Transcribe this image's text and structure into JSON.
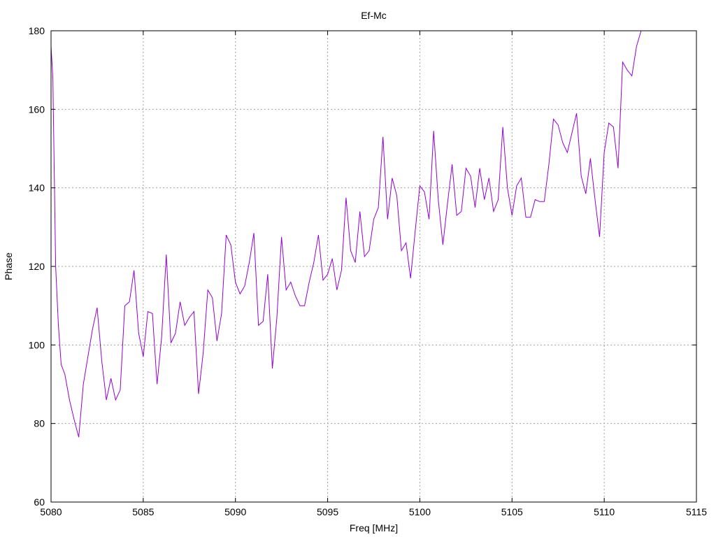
{
  "chart_data": {
    "type": "line",
    "title": "Ef-Mc",
    "xlabel": "Freq [MHz]",
    "ylabel": "Phase",
    "xlim": [
      5080,
      5115
    ],
    "ylim": [
      60,
      180
    ],
    "x_ticks": [
      5080,
      5085,
      5090,
      5095,
      5100,
      5105,
      5110,
      5115
    ],
    "y_ticks": [
      60,
      80,
      100,
      120,
      140,
      160,
      180
    ],
    "grid": true,
    "line_color": "#9400d3",
    "series": [
      {
        "x": [
          5080.0,
          5080.1,
          5080.25,
          5080.4,
          5080.55,
          5080.75,
          5081.0,
          5081.25,
          5081.5,
          5081.75,
          5082.0,
          5082.25,
          5082.5,
          5082.75,
          5083.0,
          5083.25,
          5083.5,
          5083.75,
          5084.0,
          5084.25,
          5084.5,
          5084.75,
          5085.0,
          5085.25,
          5085.5,
          5085.75,
          5086.0,
          5086.25,
          5086.5,
          5086.75,
          5087.0,
          5087.25,
          5087.5,
          5087.75,
          5088.0,
          5088.25,
          5088.5,
          5088.75,
          5089.0,
          5089.25,
          5089.5,
          5089.75,
          5090.0,
          5090.25,
          5090.5,
          5090.75,
          5091.0,
          5091.25,
          5091.5,
          5091.75,
          5092.0,
          5092.25,
          5092.5,
          5092.75,
          5093.0,
          5093.25,
          5093.5,
          5093.75,
          5094.0,
          5094.25,
          5094.5,
          5094.75,
          5095.0,
          5095.25,
          5095.5,
          5095.75,
          5096.0,
          5096.25,
          5096.5,
          5096.75,
          5097.0,
          5097.25,
          5097.5,
          5097.75,
          5098.0,
          5098.25,
          5098.5,
          5098.75,
          5099.0,
          5099.25,
          5099.5,
          5099.75,
          5100.0,
          5100.25,
          5100.5,
          5100.75,
          5101.0,
          5101.25,
          5101.5,
          5101.75,
          5102.0,
          5102.25,
          5102.5,
          5102.75,
          5103.0,
          5103.25,
          5103.5,
          5103.75,
          5104.0,
          5104.25,
          5104.5,
          5104.75,
          5105.0,
          5105.25,
          5105.5,
          5105.75,
          5106.0,
          5106.25,
          5106.5,
          5106.75,
          5107.0,
          5107.25,
          5107.5,
          5107.75,
          5108.0,
          5108.25,
          5108.5,
          5108.75,
          5109.0,
          5109.25,
          5109.5,
          5109.75,
          5110.0,
          5110.25,
          5110.5,
          5110.75,
          5111.0,
          5111.25,
          5111.5,
          5111.75,
          5112.0
        ],
        "values": [
          176,
          168,
          120,
          105,
          95,
          92.5,
          86,
          81,
          76.5,
          90,
          97,
          104,
          109.5,
          96,
          86,
          91.5,
          86,
          88.5,
          110,
          111,
          119,
          103,
          97,
          108.5,
          108,
          90,
          102,
          123,
          100.5,
          103,
          111,
          105,
          107,
          108.5,
          87.5,
          98,
          114,
          112,
          101,
          108,
          128,
          125.5,
          116,
          113,
          115,
          121,
          128.5,
          105,
          106,
          118,
          94,
          107,
          127.5,
          114,
          116,
          112.5,
          110,
          110,
          116,
          121,
          128,
          116.5,
          118,
          122,
          114,
          119,
          137.5,
          124,
          121,
          134,
          122.5,
          124,
          132,
          135,
          153,
          132,
          142.5,
          138,
          124,
          126,
          117,
          129,
          140.5,
          139,
          132,
          154.5,
          137,
          125.5,
          136,
          146,
          133,
          134,
          145,
          143,
          135,
          145,
          137,
          142.5,
          134,
          137,
          155.5,
          140,
          133,
          140.5,
          142.5,
          132.5,
          132.5,
          137,
          136.5,
          136.5,
          146,
          157.5,
          156,
          151.5,
          149,
          154,
          159,
          143,
          138.5,
          147.5,
          137,
          127.5,
          149,
          156.5,
          155.5,
          145,
          172,
          170,
          168.5,
          176,
          180
        ]
      }
    ]
  }
}
